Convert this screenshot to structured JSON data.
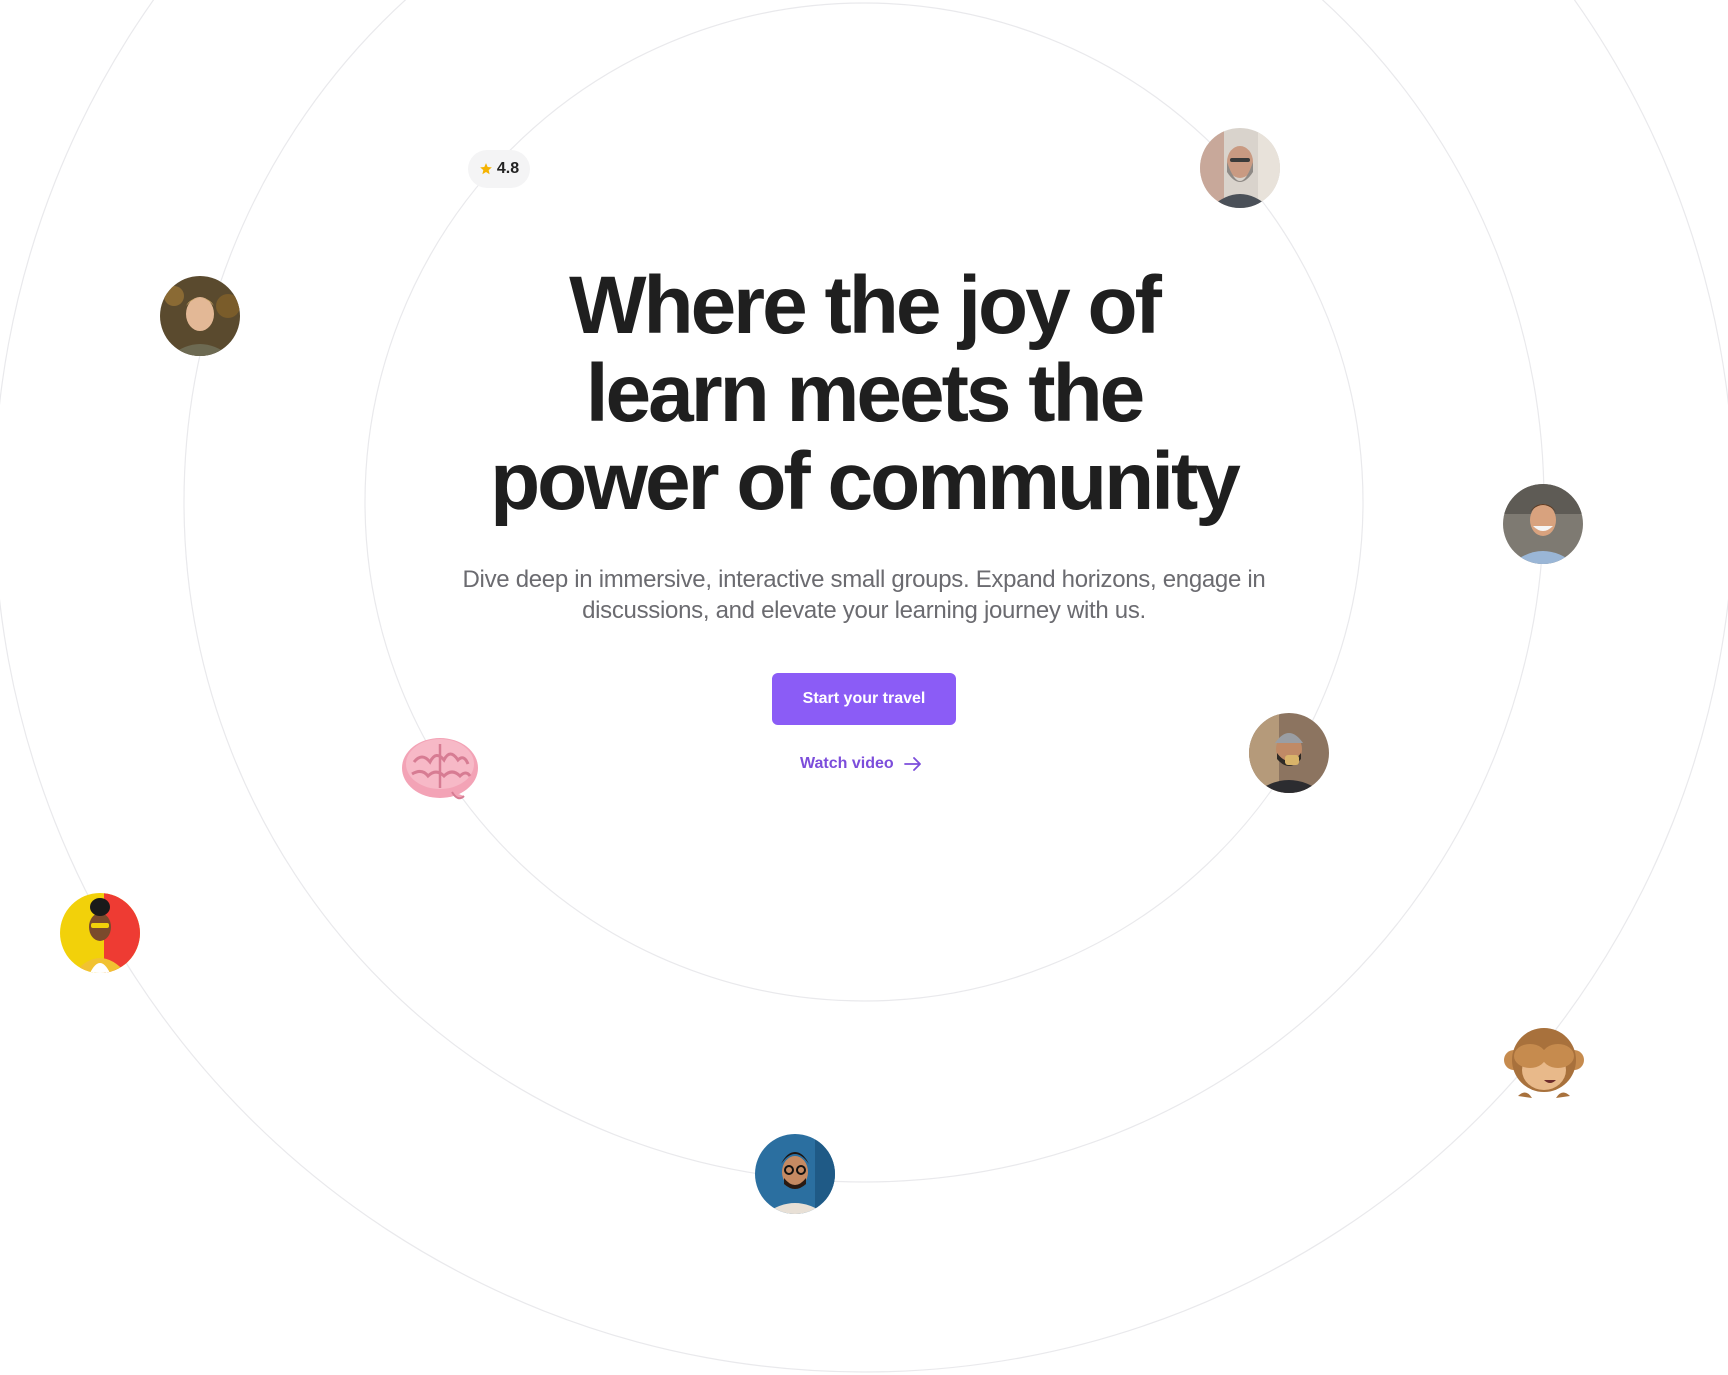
{
  "hero": {
    "title_lines": [
      "Where the joy of",
      "learn meets the",
      "power of community"
    ],
    "subtitle": "Dive deep in immersive, interactive small groups. Expand horizons, engage in discussions, and elevate your learning journey with us.",
    "cta_label": "Start your travel",
    "watch_label": "Watch video"
  },
  "rating": {
    "value": "4.8",
    "icon": "star-icon",
    "icon_color": "#f5b301"
  },
  "avatars": [
    "avatar-bearded-man",
    "avatar-blond-man",
    "avatar-smiling-man",
    "avatar-man-with-beanie",
    "avatar-woman-yellow-background",
    "avatar-man-with-glasses"
  ],
  "emojis": [
    "brain-emoji",
    "see-no-evil-monkey-emoji"
  ],
  "colors": {
    "accent": "#8b5cf6",
    "link": "#7c4ddb",
    "heading": "#1f1f1f",
    "body": "#6b6b70",
    "orbit": "#e9e9ec"
  }
}
